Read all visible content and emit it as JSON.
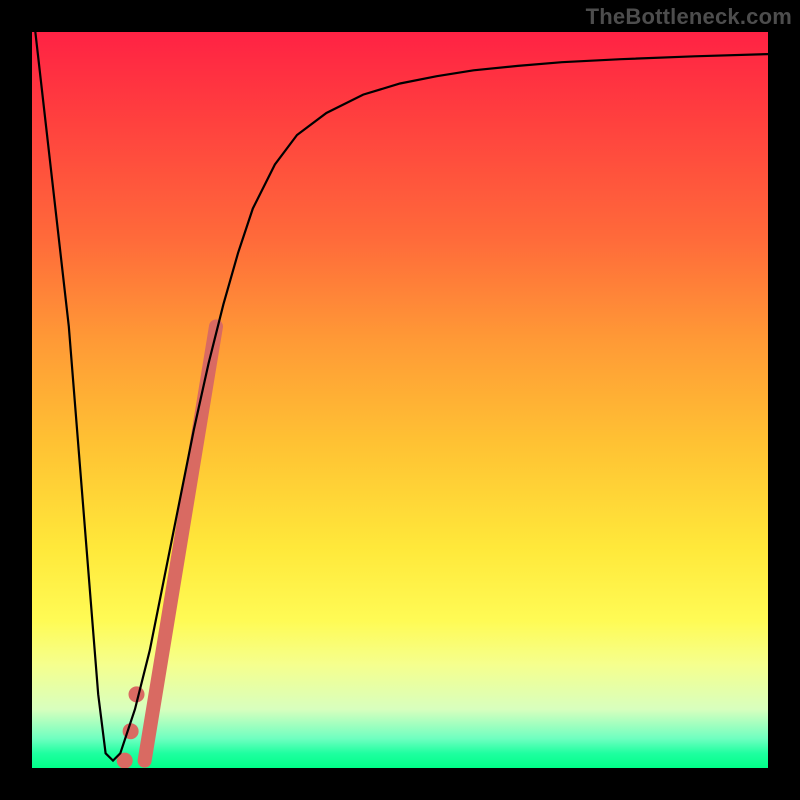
{
  "watermark": "TheBottleneck.com",
  "chart_data": {
    "type": "line",
    "title": "",
    "xlabel": "",
    "ylabel": "",
    "xlim": [
      0,
      100
    ],
    "ylim": [
      0,
      100
    ],
    "series": [
      {
        "name": "bottleneck-curve",
        "x": [
          0,
          5,
          9,
          10,
          11,
          12,
          14,
          16,
          18,
          20,
          22,
          24,
          26,
          28,
          30,
          33,
          36,
          40,
          45,
          50,
          55,
          60,
          66,
          72,
          80,
          90,
          100
        ],
        "values": [
          104,
          60,
          10,
          2,
          1,
          2,
          8,
          16,
          26,
          36,
          46,
          55,
          63,
          70,
          76,
          82,
          86,
          89,
          91.5,
          93,
          94,
          94.8,
          95.4,
          95.9,
          96.3,
          96.7,
          97
        ]
      }
    ],
    "markers": [
      {
        "name": "highlight-segment",
        "x_start": 15.3,
        "y_start": 1.0,
        "x_end": 25.0,
        "y_end": 60.0,
        "thickness": 14
      },
      {
        "name": "dot-a",
        "x": 14.2,
        "y": 10.0
      },
      {
        "name": "dot-b",
        "x": 13.4,
        "y": 5.0
      },
      {
        "name": "dot-c",
        "x": 12.6,
        "y": 1.0
      }
    ],
    "colors": {
      "curve": "#000000",
      "highlight": "#d96a62"
    }
  }
}
